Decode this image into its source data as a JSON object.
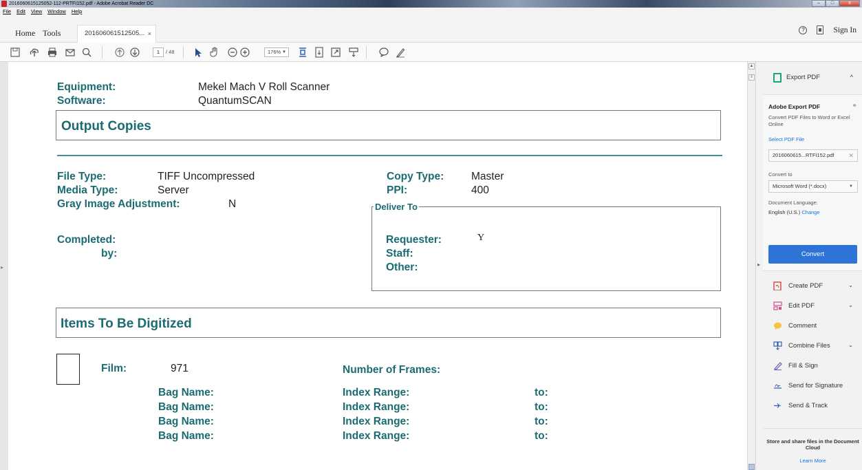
{
  "window": {
    "title": "2016060615125052-112-PRTFI152.pdf - Adobe Acrobat Reader DC",
    "minimize": "–",
    "maximize": "□",
    "close": "x"
  },
  "menu": [
    "File",
    "Edit",
    "View",
    "Window",
    "Help"
  ],
  "tabs": {
    "home": "Home",
    "tools": "Tools",
    "doc_tab": "201606061512505...",
    "doc_tab_close": "×",
    "help_glyph": "?",
    "sign_in": "Sign In"
  },
  "toolbar": {
    "page_current": "1",
    "page_total": "/ 48",
    "zoom": "176%",
    "icons": [
      "save-icon",
      "upload-icon",
      "print-icon",
      "email-icon",
      "search-icon",
      "page-up-icon",
      "page-down-icon",
      "select-cursor-icon",
      "hand-icon",
      "zoom-out-icon",
      "zoom-in-icon",
      "fit-page-icon",
      "scroll-mode-icon",
      "full-screen-icon",
      "read-mode-icon",
      "comment-icon",
      "pen-icon"
    ]
  },
  "document": {
    "equipment_label": "Equipment:",
    "equipment_value": "Mekel Mach V Roll Scanner",
    "software_label": "Software:",
    "software_value": "QuantumSCAN",
    "output_copies": "Output Copies",
    "file_type_label": "File Type:",
    "file_type_value": "TIFF Uncompressed",
    "media_type_label": "Media Type:",
    "media_type_value": "Server",
    "gray_label": "Gray Image Adjustment:",
    "gray_value": "N",
    "copy_type_label": "Copy Type:",
    "copy_type_value": "Master",
    "ppi_label": "PPI:",
    "ppi_value": "400",
    "deliver_to": "Deliver To",
    "completed_label": "Completed:",
    "by_label": "by:",
    "requester_label": "Requester:",
    "requester_value": "Y",
    "staff_label": "Staff:",
    "other_label": "Other:",
    "items_header": "Items To Be Digitized",
    "film_label": "Film:",
    "film_value": "971",
    "frames_label": "Number of Frames:",
    "bag_rows": [
      {
        "bag": "Bag Name:",
        "index": "Index Range:",
        "to": "to:"
      },
      {
        "bag": "Bag Name:",
        "index": "Index Range:",
        "to": "to:"
      },
      {
        "bag": "Bag Name:",
        "index": "Index Range:",
        "to": "to:"
      },
      {
        "bag": "Bag Name:",
        "index": "Index Range:",
        "to": "to:"
      }
    ]
  },
  "panel": {
    "export_title": "Export PDF",
    "card_title": "Adobe Export PDF",
    "card_desc": "Convert PDF Files to Word or Excel Online",
    "select_file": "Select PDF File",
    "file_name": "2016060615...RTFI152.pdf",
    "convert_to_label": "Convert to",
    "convert_to_value": "Microsoft Word (*.docx)",
    "lang_label": "Document Language:",
    "lang_value": "English (U.S.)",
    "lang_change": "Change",
    "convert_button": "Convert",
    "tools": [
      {
        "label": "Create PDF",
        "icon": "create-pdf-icon",
        "expand": true
      },
      {
        "label": "Edit PDF",
        "icon": "edit-pdf-icon",
        "expand": true
      },
      {
        "label": "Comment",
        "icon": "comment-icon",
        "expand": false
      },
      {
        "label": "Combine Files",
        "icon": "combine-files-icon",
        "expand": true
      },
      {
        "label": "Fill & Sign",
        "icon": "fill-sign-icon",
        "expand": false
      },
      {
        "label": "Send for Signature",
        "icon": "send-signature-icon",
        "expand": false
      },
      {
        "label": "Send & Track",
        "icon": "send-track-icon",
        "expand": false
      }
    ],
    "cloud_text": "Store and share files in the Document Cloud",
    "learn_more": "Learn More"
  },
  "colors": {
    "heading": "#1b6b72",
    "accent_blue": "#2d74d6",
    "link": "#1473e6"
  }
}
